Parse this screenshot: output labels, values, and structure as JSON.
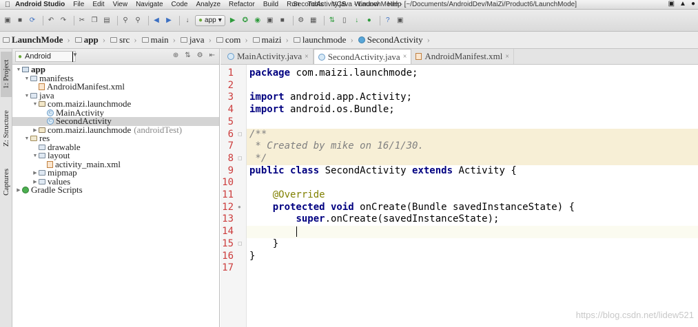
{
  "menubar": {
    "app_name": "Android Studio",
    "items": [
      "File",
      "Edit",
      "View",
      "Navigate",
      "Code",
      "Analyze",
      "Refactor",
      "Build",
      "Run",
      "Tools",
      "VCS",
      "Window",
      "Help"
    ],
    "window_title": "SecondActivity.java - LaunchMode - [~/Documents/AndroidDev/MaiZi/Product6/LaunchMode]"
  },
  "toolbar": {
    "run_config": "app"
  },
  "breadcrumb": [
    "LaunchMode",
    "app",
    "src",
    "main",
    "java",
    "com",
    "maizi",
    "launchmode",
    "SecondActivity"
  ],
  "side_tabs": {
    "project": "1: Project",
    "structure": "Z: Structure",
    "captures": "Captures"
  },
  "project_panel": {
    "view_mode": "Android",
    "tree": [
      {
        "label": "app",
        "bold": true
      },
      {
        "label": "manifests"
      },
      {
        "label": "AndroidManifest.xml"
      },
      {
        "label": "java"
      },
      {
        "label": "com.maizi.launchmode"
      },
      {
        "label": "MainActivity"
      },
      {
        "label": "SecondActivity"
      },
      {
        "label": "com.maizi.launchmode",
        "suffix": "(androidTest)"
      },
      {
        "label": "res"
      },
      {
        "label": "drawable"
      },
      {
        "label": "layout"
      },
      {
        "label": "activity_main.xml"
      },
      {
        "label": "mipmap"
      },
      {
        "label": "values"
      },
      {
        "label": "Gradle Scripts"
      }
    ]
  },
  "editor_tabs": [
    {
      "label": "MainActivity.java"
    },
    {
      "label": "SecondActivity.java",
      "active": true
    },
    {
      "label": "AndroidManifest.xml"
    }
  ],
  "editor": {
    "line_numbers": [
      "1",
      "2",
      "3",
      "4",
      "5",
      "6",
      "7",
      "8",
      "9",
      "10",
      "11",
      "12",
      "13",
      "14",
      "15",
      "16",
      "17"
    ],
    "code": {
      "l1_kw": "package",
      "l1_rest": " com.maizi.launchmode;",
      "l3_kw": "import",
      "l3_rest": " android.app.Activity;",
      "l4_kw": "import",
      "l4_rest": " android.os.Bundle;",
      "l6": "/**",
      "l7": " * Created by mike on 16/1/30.",
      "l8": " */",
      "l9_kw1": "public class",
      "l9_mid": " SecondActivity ",
      "l9_kw2": "extends",
      "l9_rest": " Activity {",
      "l11_ann": "@Override",
      "l12_kw": "protected void",
      "l12_rest": " onCreate(Bundle savedInstanceState) {",
      "l13_kw": "super",
      "l13_rest": ".onCreate(savedInstanceState);",
      "l15": "}",
      "l16": "}"
    }
  },
  "watermark": "https://blog.csdn.net/lidew521"
}
